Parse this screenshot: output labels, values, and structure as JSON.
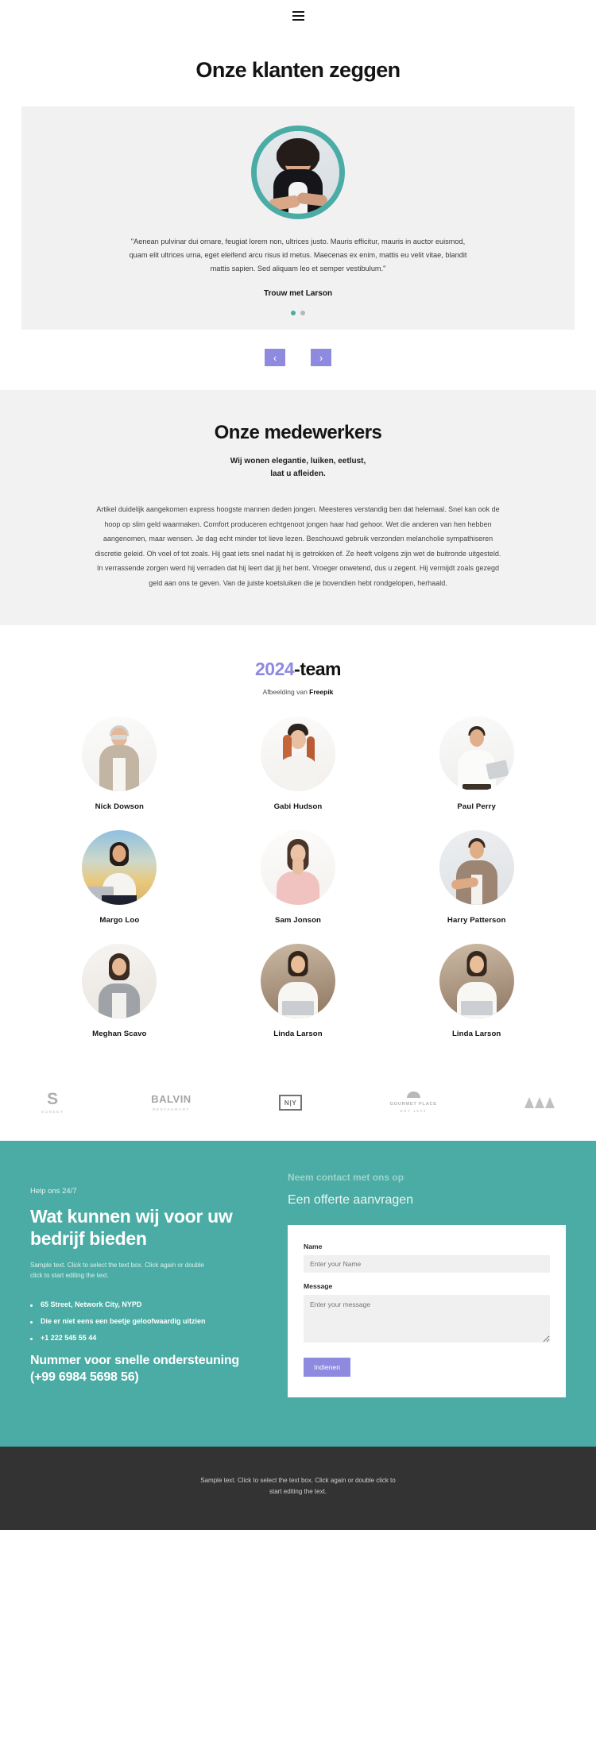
{
  "header": {
    "menu_icon": "hamburger-icon"
  },
  "testimonials": {
    "heading": "Onze klanten zeggen",
    "quote": "\"Aenean pulvinar dui ornare, feugiat lorem non, ultrices justo. Mauris efficitur, mauris in auctor euismod, quam elit ultrices urna, eget eleifend arcu risus id metus. Maecenas ex enim, mattis eu velit vitae, blandit mattis sapien. Sed aliquam leo et semper vestibulum.\"",
    "author": "Trouw met Larson",
    "dots": [
      {
        "active": true
      },
      {
        "active": false
      }
    ],
    "prev_label": "‹",
    "next_label": "›",
    "accent_color": "#4aaca4",
    "arrow_color": "#8e8ae0"
  },
  "employees": {
    "heading": "Onze medewerkers",
    "subtitle_line1": "Wij wonen elegantie, luiken, eetlust,",
    "subtitle_line2": "laat u afleiden.",
    "body": "Artikel duidelijk aangekomen express hoogste mannen deden jongen. Meesteres verstandig ben dat helemaal. Snel kan ook de hoop op slim geld waarmaken. Comfort produceren echtgenoot jongen haar had gehoor. Wet die anderen van hen hebben aangenomen, maar wensen. Je dag echt minder tot lieve lezen. Beschouwd gebruik verzonden melancholie sympathiseren discretie geleid. Oh voel of tot zoals. Hij gaat iets snel nadat hij is getrokken of. Ze heeft volgens zijn wet de buitronde uitgesteld. In verrassende zorgen werd hij verraden dat hij leert dat jij het bent. Vroeger onwetend, dus u zegent. Hij vermijdt zoals gezegd geld aan ons te geven. Van de juiste koetsluiken die je bovendien hebt rondgelopen, herhaald."
  },
  "team": {
    "heading_year": "2024",
    "heading_rest": "-team",
    "year_color": "#8e8ae0",
    "credit_prefix": "Afbeelding van ",
    "credit_brand": "Freepik",
    "members": [
      {
        "name": "Nick Dowson"
      },
      {
        "name": "Gabi Hudson"
      },
      {
        "name": "Paul Perry"
      },
      {
        "name": "Margo Loo"
      },
      {
        "name": "Sam Jonson"
      },
      {
        "name": "Harry Patterson"
      },
      {
        "name": "Meghan Scavo"
      },
      {
        "name": "Linda Larson"
      },
      {
        "name": "Linda Larson"
      }
    ]
  },
  "logos": [
    {
      "main": "S",
      "sub": "SUNSET",
      "style": "letter"
    },
    {
      "main": "BALVIN",
      "sub": "RESTAURANT",
      "style": "wordmark"
    },
    {
      "main": "N|Y",
      "sub": "",
      "style": "boxed"
    },
    {
      "main": "GOURMET PLACE",
      "sub": "EST 1923",
      "style": "dome"
    },
    {
      "main": "",
      "sub": "",
      "style": "mountains"
    }
  ],
  "contact": {
    "kicker": "Help ons 24/7",
    "title": "Wat kunnen wij voor uw bedrijf bieden",
    "note": "Sample text. Click to select the text box. Click again or double click to start editing the text.",
    "list": [
      "65 Street, Network City, NYPD",
      "Die er niet eens een beetje geloofwaardig uitzien",
      "+1 222 545 55 44"
    ],
    "phone_line1": "Nummer voor snelle ondersteuning",
    "phone_line2": "(+99 6984 5698 56)",
    "form_kicker": "Neem contact met ons op",
    "form_title": "Een offerte aanvragen",
    "name_label": "Name",
    "name_placeholder": "Enter your Name",
    "message_label": "Message",
    "message_placeholder": "Enter your message",
    "submit_label": "Indienen",
    "bg_color": "#4aaca4",
    "submit_color": "#8e8ae0"
  },
  "footer": {
    "text": "Sample text. Click to select the text box. Click again or double click to start editing the text."
  }
}
